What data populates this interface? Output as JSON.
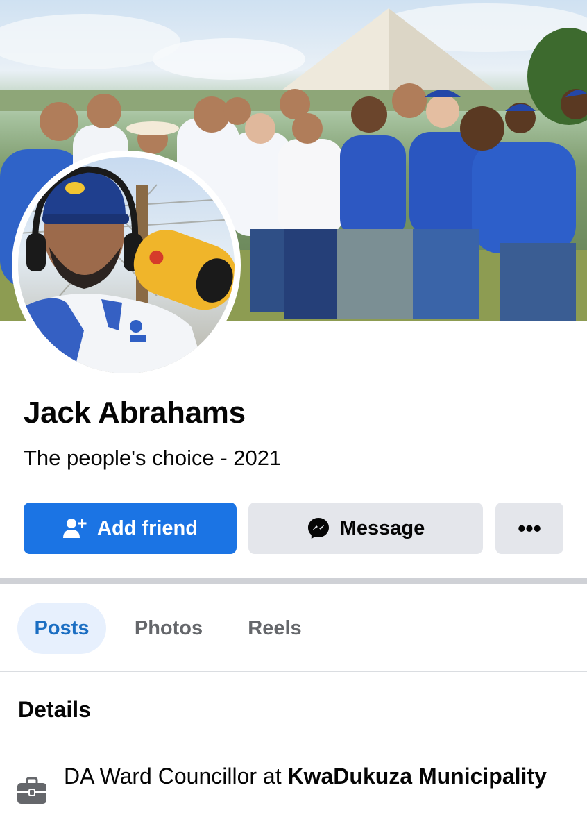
{
  "profile": {
    "name": "Jack Abrahams",
    "bio": "The people's choice - 2021"
  },
  "actions": {
    "add_friend_label": "Add friend",
    "message_label": "Message",
    "more_label": "•••"
  },
  "tabs": [
    {
      "label": "Posts",
      "active": true
    },
    {
      "label": "Photos",
      "active": false
    },
    {
      "label": "Reels",
      "active": false
    }
  ],
  "details": {
    "title": "Details",
    "work_prefix": "DA Ward Councillor at ",
    "work_place": "KwaDukuza Municipality"
  },
  "colors": {
    "primary_button": "#1b74e4",
    "secondary_button": "#e4e6eb",
    "active_tab_bg": "#e7f0fd",
    "active_tab_text": "#1b6ec2"
  },
  "icons": {
    "add_friend": "person-plus-icon",
    "message": "messenger-icon",
    "more": "more-dots-icon",
    "work": "briefcase-icon"
  }
}
